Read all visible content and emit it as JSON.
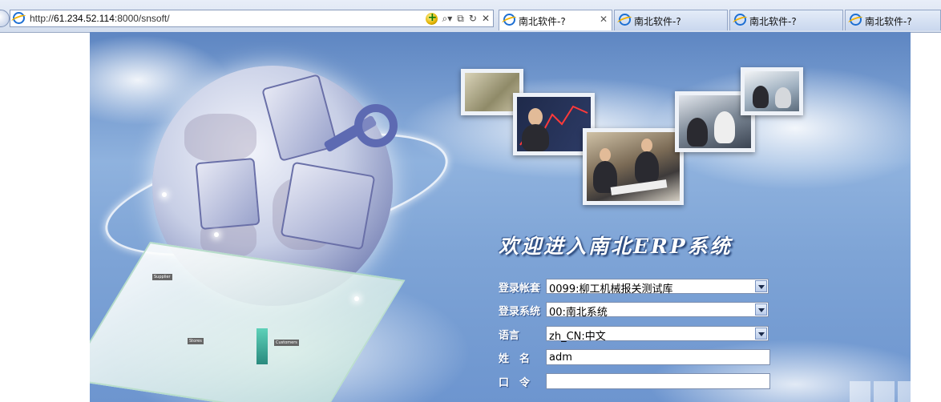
{
  "browser": {
    "address": {
      "url_prefix": "http://",
      "url_host": "61.234.52.114",
      "url_rest": ":8000/snsoft/"
    },
    "tabs": [
      {
        "label": "南北软件-?",
        "active": true
      },
      {
        "label": "南北软件-?",
        "active": false
      },
      {
        "label": "南北软件-?",
        "active": false
      },
      {
        "label": "南北软件-?",
        "active": false
      }
    ]
  },
  "page": {
    "welcome": "欢迎进入南北ERP系统",
    "diagram_labels": {
      "supplier": "Supplier",
      "stores": "Stores",
      "customers": "Customers"
    },
    "form": {
      "account_set_label": "登录帐套",
      "account_set_value": "0099:柳工机械报关测试库",
      "system_label": "登录系统",
      "system_value": "00:南北系统",
      "language_label": "语言",
      "language_value": "zh_CN:中文",
      "username_label": "姓　名",
      "username_value": "adm",
      "password_label": "口　令",
      "password_value": ""
    }
  },
  "colors": {
    "accent": "#1d6fd2",
    "banner_sky": "#8fb2de"
  }
}
